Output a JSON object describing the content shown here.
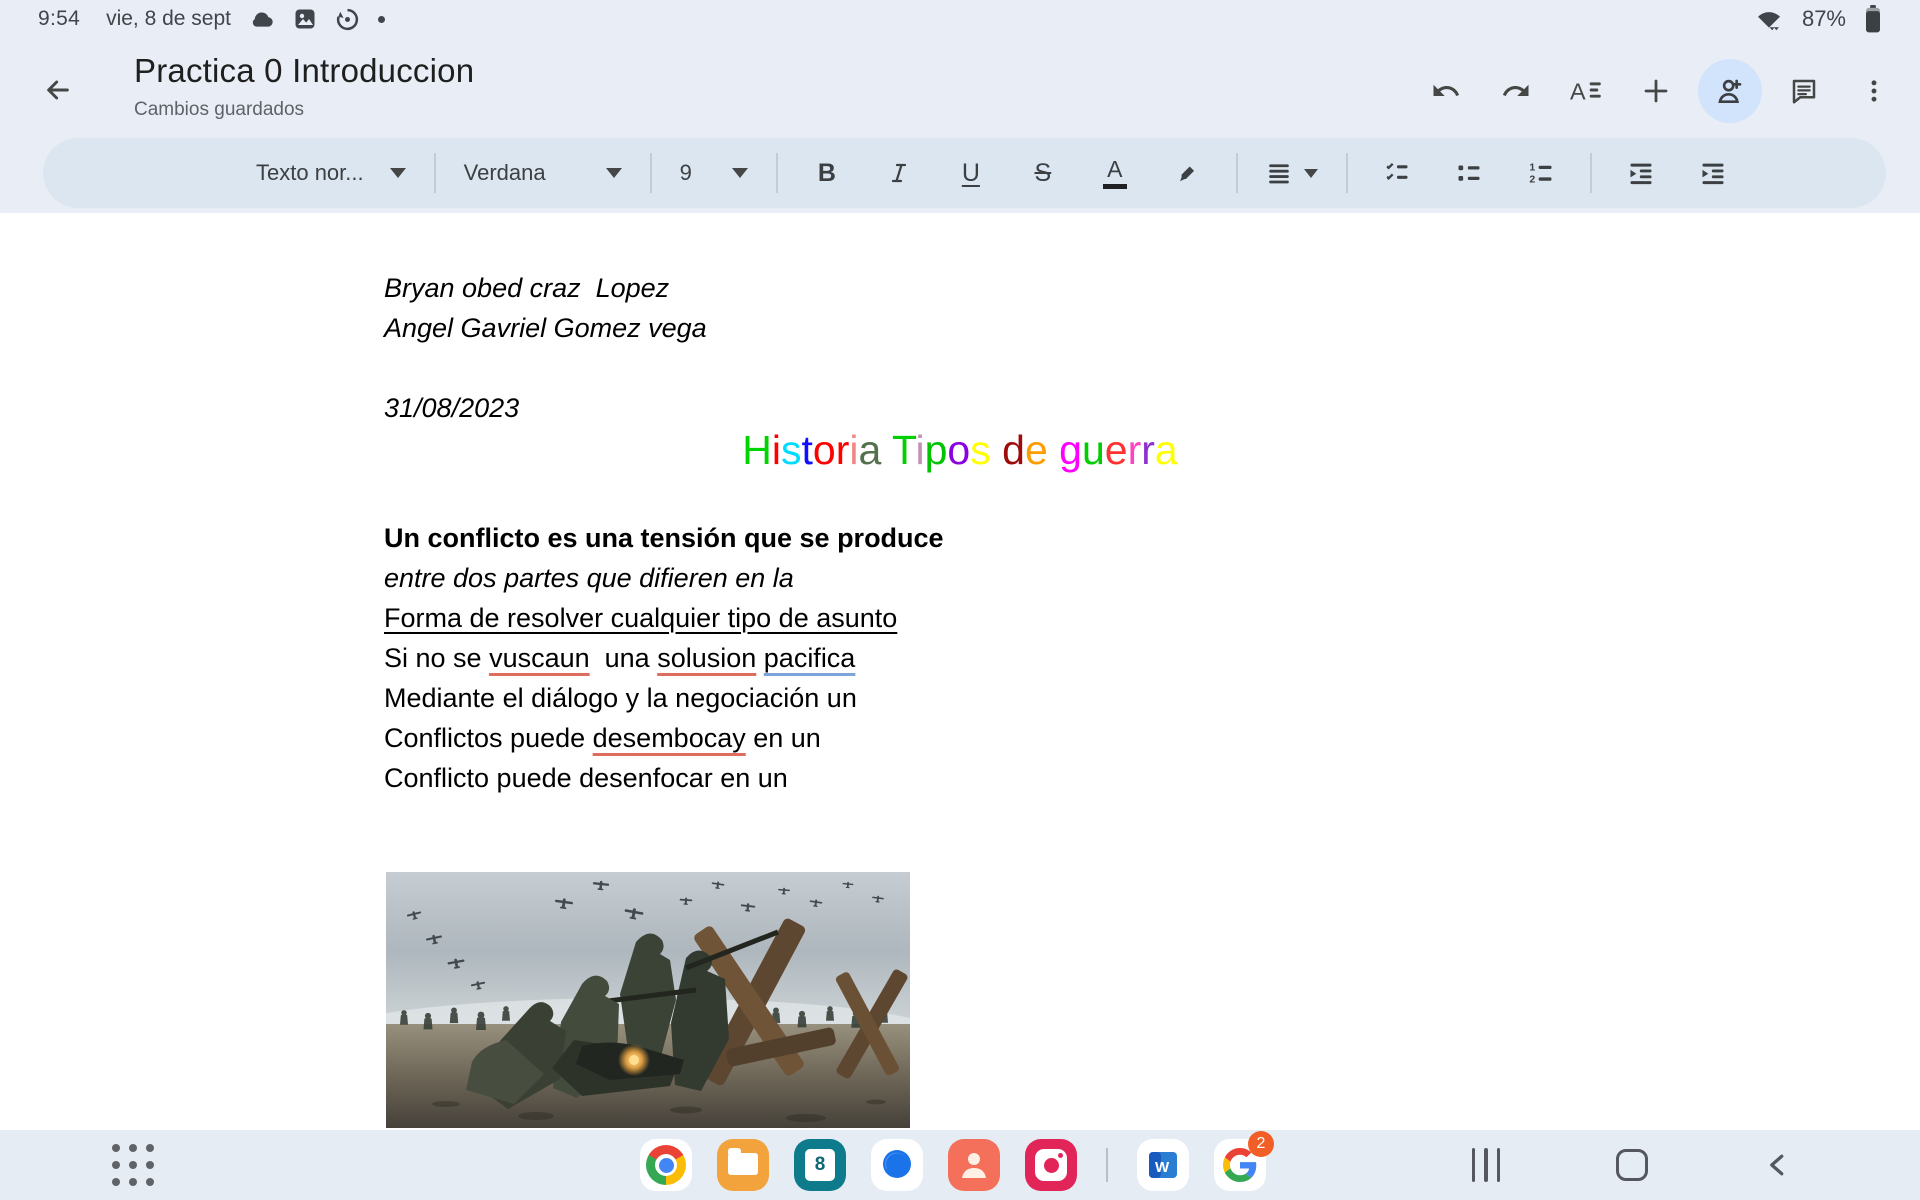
{
  "status_bar": {
    "time": "9:54",
    "date": "vie, 8 de sept",
    "battery_percent": "87%",
    "left_icons": [
      "cloud-icon",
      "gallery-icon",
      "data-saver-icon",
      "notification-dot"
    ],
    "right_icons": [
      "wifi-icon",
      "battery-icon"
    ]
  },
  "header": {
    "title": "Practica 0 Introduccion",
    "subtitle": "Cambios guardados",
    "actions": [
      "back",
      "undo",
      "redo",
      "font-options",
      "insert",
      "share",
      "comments",
      "more-options"
    ]
  },
  "toolbar": {
    "paragraph_style": "Texto nor...",
    "font_family": "Verdana",
    "font_size": "9",
    "buttons": [
      "bold",
      "italic",
      "underline",
      "strikethrough",
      "text-color",
      "highlight-color",
      "align",
      "checklist",
      "bulleted-list",
      "numbered-list",
      "outdent",
      "indent"
    ]
  },
  "doc": {
    "intro_lines": [
      "Bryan obed craz  Lopez",
      "Angel Gavriel Gomez vega",
      "",
      "31/08/2023"
    ],
    "title_text": "Historia Tipos de guerra",
    "title_letters": [
      {
        "ch": "H",
        "c": "#00d400"
      },
      {
        "ch": "i",
        "c": "#ff0000"
      },
      {
        "ch": "s",
        "c": "#00dcff"
      },
      {
        "ch": "t",
        "c": "#1010ff"
      },
      {
        "ch": "o",
        "c": "#ff0000"
      },
      {
        "ch": "r",
        "c": "#ff0000"
      },
      {
        "ch": "i",
        "c": "#f08888"
      },
      {
        "ch": "a",
        "c": "#54714e"
      },
      {
        "ch": " ",
        "c": "#000000"
      },
      {
        "ch": "T",
        "c": "#00d000"
      },
      {
        "ch": "i",
        "c": "#c490b8"
      },
      {
        "ch": "p",
        "c": "#00c400"
      },
      {
        "ch": "o",
        "c": "#8a00e0"
      },
      {
        "ch": "s",
        "c": "#ffff00"
      },
      {
        "ch": " ",
        "c": "#000000"
      },
      {
        "ch": "d",
        "c": "#9e0b0b"
      },
      {
        "ch": "e",
        "c": "#ff9c00"
      },
      {
        "ch": " ",
        "c": "#000000"
      },
      {
        "ch": "g",
        "c": "#ff00ff"
      },
      {
        "ch": "u",
        "c": "#00cc00"
      },
      {
        "ch": "e",
        "c": "#ff3030"
      },
      {
        "ch": "r",
        "c": "#ff44c0"
      },
      {
        "ch": "r",
        "c": "#8c30d0"
      },
      {
        "ch": "a",
        "c": "#ffff00"
      }
    ],
    "body_lines": [
      {
        "style": "bold",
        "segments": [
          {
            "text": "Un conflicto es una tensión que se produce"
          }
        ]
      },
      {
        "style": "italic",
        "segments": [
          {
            "text": "entre dos partes que difieren en la"
          }
        ]
      },
      {
        "style": "uline",
        "segments": [
          {
            "text": "Forma de resolver cualquier tipo de asunto"
          }
        ]
      },
      {
        "style": "normal",
        "segments": [
          {
            "text": "Si no se "
          },
          {
            "text": "vuscaun",
            "mark": "red"
          },
          {
            "text": "  una "
          },
          {
            "text": "solusion",
            "mark": "red"
          },
          {
            "text": " "
          },
          {
            "text": "pacifica",
            "mark": "blue"
          }
        ]
      },
      {
        "style": "normal",
        "segments": [
          {
            "text": "Mediante el diálogo y la negociación un"
          }
        ]
      },
      {
        "style": "normal",
        "segments": [
          {
            "text": "Conflictos puede "
          },
          {
            "text": "desembocay",
            "mark": "red"
          },
          {
            "text": " en un"
          }
        ]
      },
      {
        "style": "normal",
        "segments": [
          {
            "text": "Conflicto puede desenfocar en un"
          }
        ]
      }
    ],
    "image_description": "WWII beach battle scene: soldiers advancing with rifles among wooden obstacles, planes overhead"
  },
  "colors": {
    "spellcheck_red": "#e06b5f",
    "spellcheck_blue": "#7da4db",
    "share_highlight": "#d2e3fc",
    "badge_orange": "#f25f26"
  },
  "taskbar": {
    "apps": [
      "chrome",
      "my-files",
      "calendar-day-8",
      "messages",
      "contacts",
      "camera",
      "word",
      "google"
    ],
    "calendar_day": "8",
    "google_badge": "2",
    "nav": [
      "recents",
      "home",
      "back"
    ]
  }
}
